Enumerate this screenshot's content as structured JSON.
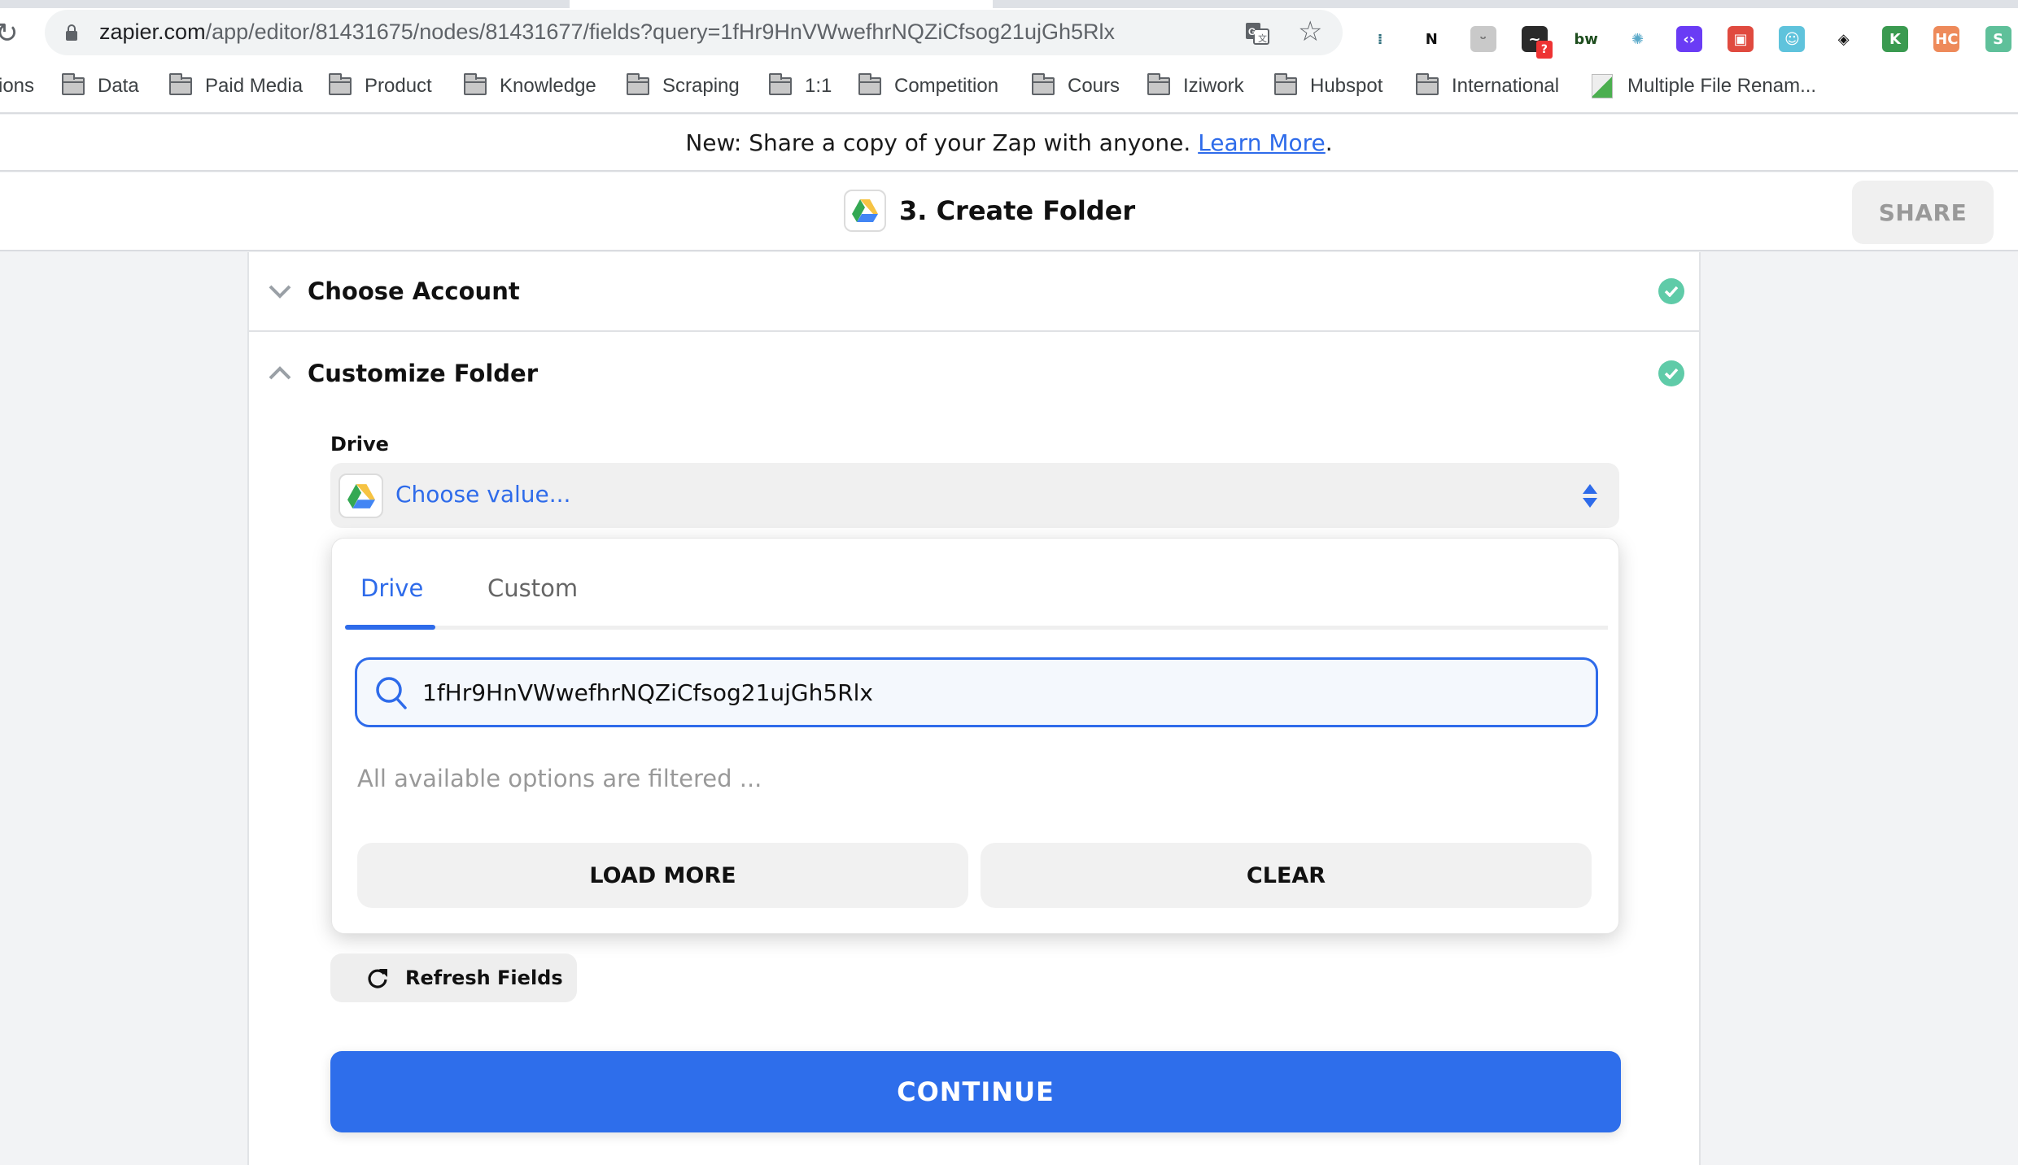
{
  "browser": {
    "url_host": "zapier.com",
    "url_path": "/app/editor/81431675/nodes/81431677/fields?query=1fHr9HnVWwefhrNQZiCfsog21ujGh5Rlx",
    "extensions": [
      {
        "name": "hockeystack-extension",
        "glyph": "⁞",
        "bg": "#ffffff",
        "fg": "#2b6c7a"
      },
      {
        "name": "notion-extension",
        "glyph": "N",
        "bg": "#ffffff",
        "fg": "#111111"
      },
      {
        "name": "battery-extension",
        "glyph": "ᵕ",
        "bg": "#c9c9c9",
        "fg": "#777777"
      },
      {
        "name": "analytics-extension",
        "glyph": "~",
        "bg": "#2a2a2a",
        "fg": "#ffffff",
        "badge": "?"
      },
      {
        "name": "bw-extension",
        "glyph": "bw",
        "bg": "#ffffff",
        "fg": "#1f4e1f"
      },
      {
        "name": "web-extension",
        "glyph": "✺",
        "bg": "#ffffff",
        "fg": "#5aa9c9"
      },
      {
        "name": "code-extension",
        "glyph": "‹›",
        "bg": "#6a3cf5",
        "fg": "#ffffff"
      },
      {
        "name": "vpn-extension",
        "glyph": "▣",
        "bg": "#e04a3f",
        "fg": "#ffffff"
      },
      {
        "name": "ghost-extension",
        "glyph": "☺",
        "bg": "#5fc3dc",
        "fg": "#ffffff"
      },
      {
        "name": "layers-extension",
        "glyph": "◈",
        "bg": "#ffffff",
        "fg": "#111111"
      },
      {
        "name": "k-extension",
        "glyph": "K",
        "bg": "#3a9a50",
        "fg": "#ffffff"
      },
      {
        "name": "hc-extension",
        "glyph": "HC",
        "bg": "#ee8a5a",
        "fg": "#ffffff"
      },
      {
        "name": "s-extension",
        "glyph": "S",
        "bg": "#5fc09a",
        "fg": "#ffffff"
      }
    ]
  },
  "bookmarks": [
    {
      "label": "ions",
      "folder": false
    },
    {
      "label": "Data",
      "folder": true
    },
    {
      "label": "Paid Media",
      "folder": true
    },
    {
      "label": "Product",
      "folder": true
    },
    {
      "label": "Knowledge",
      "folder": true
    },
    {
      "label": "Scraping",
      "folder": true
    },
    {
      "label": "1:1",
      "folder": true
    },
    {
      "label": "Competition",
      "folder": true
    },
    {
      "label": "Cours",
      "folder": true
    },
    {
      "label": "Iziwork",
      "folder": true
    },
    {
      "label": "Hubspot",
      "folder": true
    },
    {
      "label": "International",
      "folder": true
    },
    {
      "label": "Multiple File Renam...",
      "folder": false
    }
  ],
  "banner": {
    "text": "New: Share a copy of your Zap with anyone. ",
    "link": "Learn More",
    "suffix": "."
  },
  "header": {
    "title": "3. Create Folder",
    "share_label": "SHARE"
  },
  "sections": {
    "choose_account": {
      "title": "Choose Account",
      "complete": true
    },
    "customize_folder": {
      "title": "Customize Folder",
      "complete": true
    }
  },
  "drive_field": {
    "label": "Drive",
    "placeholder": "Choose value..."
  },
  "dropdown": {
    "tabs": [
      {
        "label": "Drive",
        "active": true
      },
      {
        "label": "Custom",
        "active": false
      }
    ],
    "search_value": "1fHr9HnVWwefhrNQZiCfsog21ujGh5Rlx",
    "empty_message": "All available options are filtered ...",
    "load_more_label": "LOAD MORE",
    "clear_label": "CLEAR"
  },
  "refresh_label": "Refresh Fields",
  "continue_label": "CONTINUE",
  "colors": {
    "accent": "#2e6eeb",
    "success": "#5fcba8",
    "link": "#2e6bea"
  }
}
